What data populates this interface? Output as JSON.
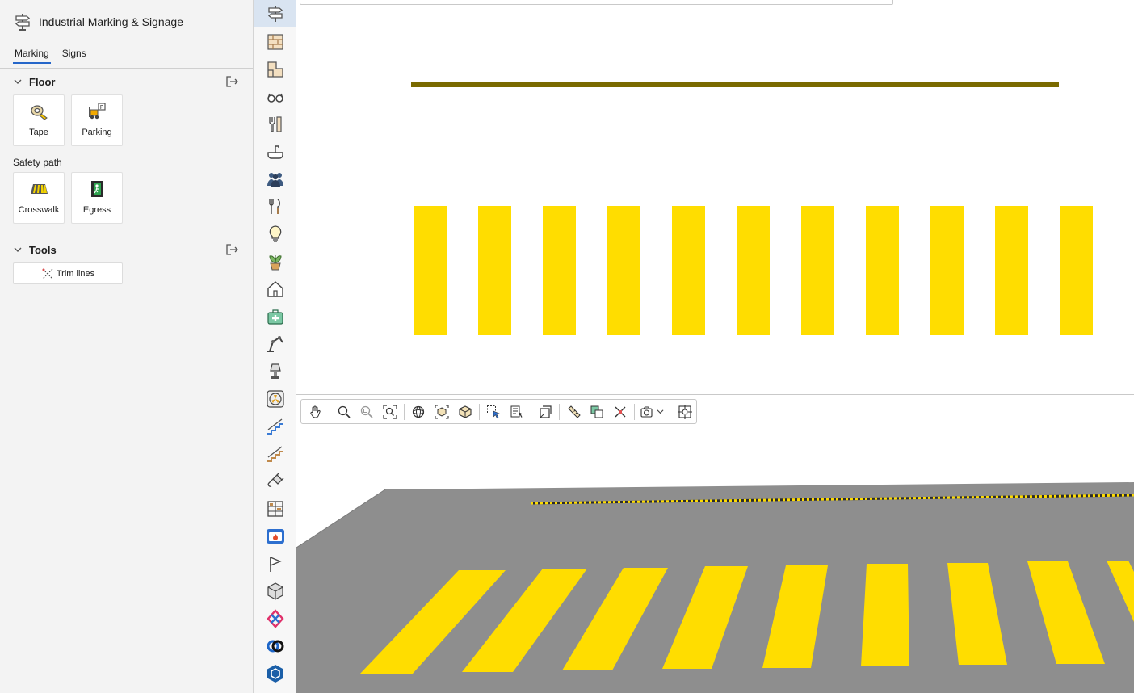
{
  "app": {
    "title": "Industrial Marking & Signage"
  },
  "tabs": [
    {
      "label": "Marking",
      "active": true
    },
    {
      "label": "Signs",
      "active": false
    }
  ],
  "floor": {
    "heading": "Floor",
    "items": [
      {
        "label": "Tape",
        "icon": "tape-icon"
      },
      {
        "label": "Parking",
        "icon": "forklift-parking-icon"
      }
    ],
    "safety_path": {
      "heading": "Safety path",
      "items": [
        {
          "label": "Crosswalk",
          "icon": "crosswalk-icon"
        },
        {
          "label": "Egress",
          "icon": "egress-icon"
        }
      ]
    }
  },
  "tools": {
    "heading": "Tools",
    "items": [
      {
        "label": "Trim lines",
        "icon": "trim-lines-icon"
      }
    ]
  },
  "sidebar_icons": [
    "signpost-icon",
    "wall-icon",
    "floor-plan-icon",
    "glasses-icon",
    "tools-icon",
    "bathroom-icon",
    "people-icon",
    "kitchen-icon",
    "lightbulb-icon",
    "plant-icon",
    "home-icon",
    "first-aid-icon",
    "robot-arm-icon",
    "lamp-icon",
    "fan-icon",
    "stairs-blue-icon",
    "stairs-wood-icon",
    "plug-icon",
    "shelving-icon",
    "fire-panel-icon",
    "flag-icon",
    "cube-icon",
    "colored-cube-icon",
    "rings-icon",
    "sketchup-icon"
  ],
  "view_toolbar": [
    "pan-icon",
    "zoom-icon",
    "zoom-window-icon",
    "zoom-extents-icon",
    "orbit-icon",
    "iso-view-icon",
    "3d-box-icon",
    "select-icon",
    "select-list-icon",
    "rotate-view-icon",
    "measure-icon",
    "section-icon",
    "close-x-icon",
    "camera-icon",
    "target-icon"
  ],
  "colors": {
    "marking_yellow": "#FFDD00",
    "olive_line": "#7A6A00",
    "floor_grey": "#8E8E8E",
    "active_blue": "#2566C9"
  }
}
